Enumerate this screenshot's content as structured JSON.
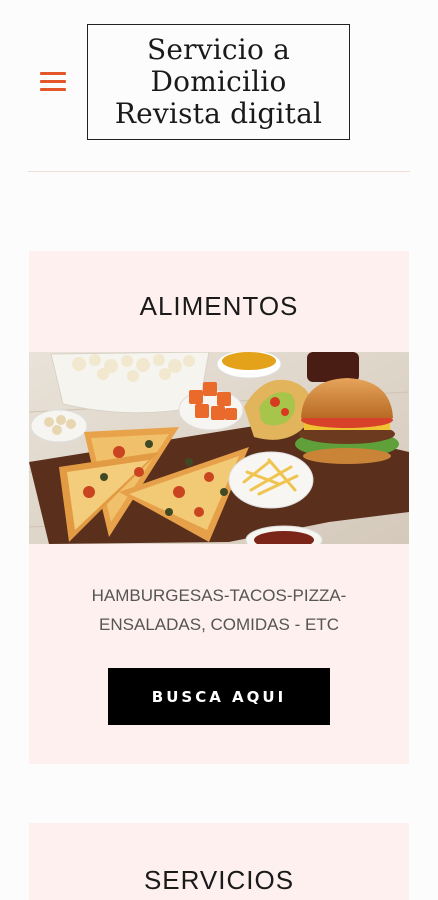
{
  "header": {
    "logo_lines": [
      "Servicio a",
      "Domicilio",
      "Revista digital"
    ],
    "menu_icon": "hamburger-menu-icon"
  },
  "sections": {
    "food": {
      "title": "ALIMENTOS",
      "description_lines": [
        "HAMBURGESAS-TACOS-PIZZA-",
        "ENSALADAS, COMIDAS - ETC"
      ],
      "button_label": "BUSCA AQUI"
    },
    "services": {
      "title": "SERVICIOS"
    }
  },
  "colors": {
    "accent": "#e2562a",
    "card_background": "#fdf0ee",
    "button_background": "#000000"
  }
}
